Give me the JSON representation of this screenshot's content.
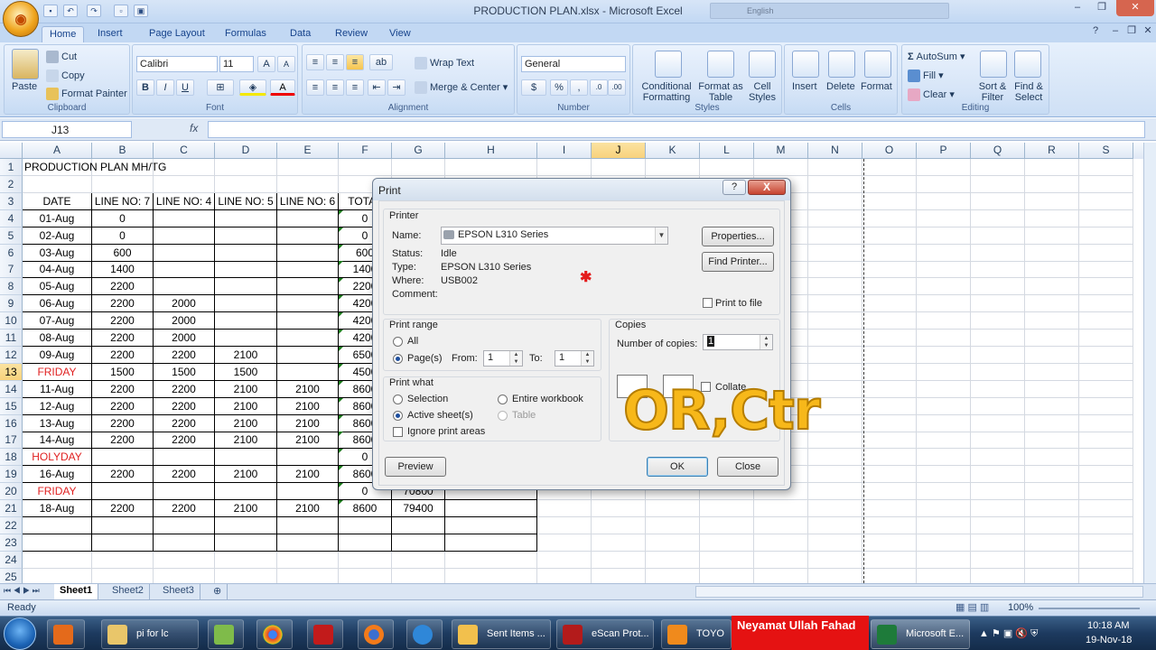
{
  "window": {
    "title": "PRODUCTION PLAN.xlsx - Microsoft Excel",
    "language": "English"
  },
  "tabs": [
    "Home",
    "Insert",
    "Page Layout",
    "Formulas",
    "Data",
    "Review",
    "View"
  ],
  "ribbon": {
    "clipboard": {
      "label": "Clipboard",
      "paste": "Paste",
      "cut": "Cut",
      "copy": "Copy",
      "format_painter": "Format Painter"
    },
    "font": {
      "label": "Font",
      "name": "Calibri",
      "size": "11",
      "bold": "B",
      "italic": "I",
      "underline": "U"
    },
    "alignment": {
      "label": "Alignment",
      "wrap": "Wrap Text",
      "merge": "Merge & Center"
    },
    "number": {
      "label": "Number",
      "format": "General"
    },
    "styles": {
      "label": "Styles",
      "conditional": "Conditional Formatting",
      "format_table": "Format as Table",
      "cell_styles": "Cell Styles"
    },
    "cells": {
      "label": "Cells",
      "insert": "Insert",
      "delete": "Delete",
      "format": "Format"
    },
    "editing": {
      "label": "Editing",
      "autosum": "AutoSum",
      "fill": "Fill",
      "clear": "Clear",
      "sort": "Sort & Filter",
      "find": "Find & Select"
    }
  },
  "formula_bar": {
    "name_box": "J13",
    "fx": "fx",
    "value": ""
  },
  "columns": [
    "A",
    "B",
    "C",
    "D",
    "E",
    "F",
    "G",
    "H",
    "I",
    "J",
    "K",
    "L",
    "M",
    "N",
    "O",
    "P",
    "Q",
    "R",
    "S"
  ],
  "rows": [
    [
      "PRODUCTION PLAN MH/TG",
      "",
      "",
      "",
      "",
      "",
      ""
    ],
    [
      "",
      "",
      "",
      "",
      "",
      "",
      ""
    ],
    [
      "DATE",
      "LINE NO: 7",
      "LINE NO: 4",
      "LINE NO: 5",
      "LINE NO: 6",
      "TOTAL",
      ""
    ],
    [
      "01-Aug",
      "0",
      "",
      "",
      "",
      "0",
      ""
    ],
    [
      "02-Aug",
      "0",
      "",
      "",
      "",
      "0",
      ""
    ],
    [
      "03-Aug",
      "600",
      "",
      "",
      "",
      "600",
      ""
    ],
    [
      "04-Aug",
      "1400",
      "",
      "",
      "",
      "1400",
      ""
    ],
    [
      "05-Aug",
      "2200",
      "",
      "",
      "",
      "2200",
      ""
    ],
    [
      "06-Aug",
      "2200",
      "2000",
      "",
      "",
      "4200",
      ""
    ],
    [
      "07-Aug",
      "2200",
      "2000",
      "",
      "",
      "4200",
      ""
    ],
    [
      "08-Aug",
      "2200",
      "2000",
      "",
      "",
      "4200",
      ""
    ],
    [
      "09-Aug",
      "2200",
      "2200",
      "2100",
      "",
      "6500",
      ""
    ],
    [
      "FRIDAY",
      "1500",
      "1500",
      "1500",
      "",
      "4500",
      ""
    ],
    [
      "11-Aug",
      "2200",
      "2200",
      "2100",
      "2100",
      "8600",
      ""
    ],
    [
      "12-Aug",
      "2200",
      "2200",
      "2100",
      "2100",
      "8600",
      ""
    ],
    [
      "13-Aug",
      "2200",
      "2200",
      "2100",
      "2100",
      "8600",
      ""
    ],
    [
      "14-Aug",
      "2200",
      "2200",
      "2100",
      "2100",
      "8600",
      ""
    ],
    [
      "HOLYDAY",
      "",
      "",
      "",
      "",
      "0",
      ""
    ],
    [
      "16-Aug",
      "2200",
      "2200",
      "2100",
      "2100",
      "8600",
      ""
    ],
    [
      "FRIDAY",
      "",
      "",
      "",
      "",
      "0",
      "70800"
    ],
    [
      "18-Aug",
      "2200",
      "2200",
      "2100",
      "2100",
      "8600",
      "79400"
    ],
    [
      "",
      "",
      "",
      "",
      "",
      "",
      ""
    ],
    [
      "",
      "",
      "",
      "",
      "",
      "",
      ""
    ],
    [
      "",
      "",
      "",
      "",
      "",
      "",
      ""
    ],
    [
      "",
      "",
      "",
      "",
      "",
      "",
      ""
    ]
  ],
  "sheets": [
    "Sheet1",
    "Sheet2",
    "Sheet3"
  ],
  "status": {
    "ready": "Ready",
    "zoom": "100%"
  },
  "dialog": {
    "title": "Print",
    "help": "?",
    "close": "X",
    "printer_group": "Printer",
    "name_label": "Name:",
    "printer_name": "EPSON L310 Series",
    "status_label": "Status:",
    "status_value": "Idle",
    "type_label": "Type:",
    "type_value": "EPSON L310 Series",
    "where_label": "Where:",
    "where_value": "USB002",
    "comment_label": "Comment:",
    "properties": "Properties...",
    "find_printer": "Find Printer...",
    "print_to_file": "Print to file",
    "range_group": "Print range",
    "all": "All",
    "pages": "Page(s)",
    "from": "From:",
    "from_value": "1",
    "to": "To:",
    "to_value": "1",
    "what_group": "Print what",
    "selection": "Selection",
    "entire_workbook": "Entire workbook",
    "active_sheets": "Active sheet(s)",
    "table": "Table",
    "ignore_areas": "Ignore print areas",
    "copies_group": "Copies",
    "number_of_copies": "Number of copies:",
    "copies_value": "1",
    "collate": "Collate",
    "preview": "Preview",
    "ok": "OK",
    "close_btn": "Close"
  },
  "overlay_text": "OR,Ctr",
  "taskbar": {
    "items": [
      "pi for lc",
      "Sent Items ...",
      "eScan Prot...",
      "TOYO",
      "Microsoft E..."
    ],
    "label": "Neyamat Ullah Fahad",
    "time": "10:18 AM",
    "date": "19-Nov-18"
  }
}
